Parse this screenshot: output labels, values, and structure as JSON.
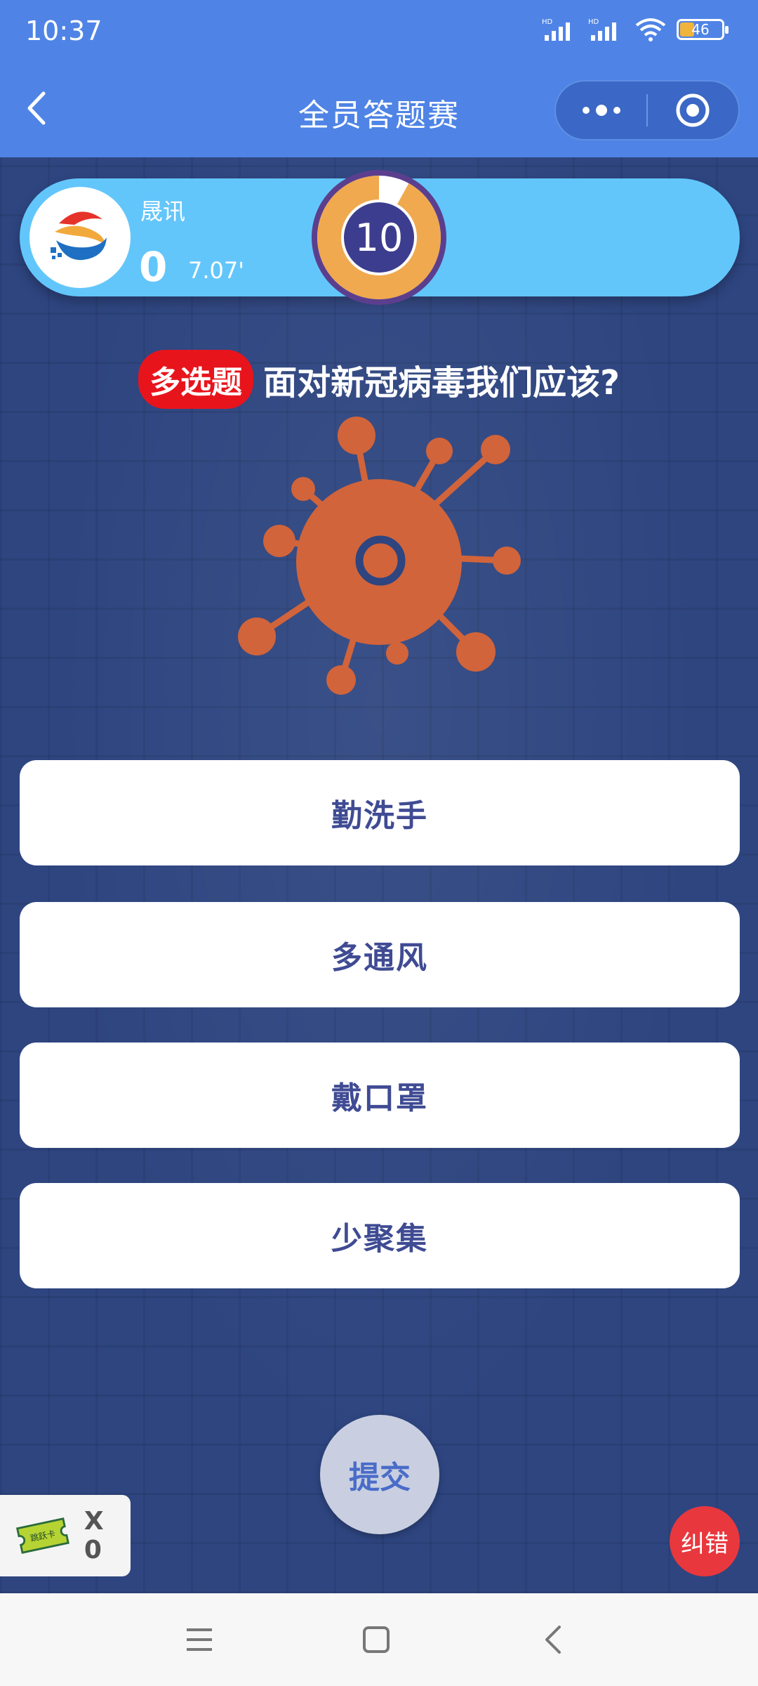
{
  "status_bar": {
    "time": "10:37",
    "battery": "46"
  },
  "nav": {
    "title": "全员答题赛"
  },
  "player": {
    "name": "晟讯",
    "score": "0",
    "time": "7.07'"
  },
  "timer": {
    "seconds": "10",
    "progress_fraction": 0.92
  },
  "question": {
    "type_badge": "多选题",
    "text": "面对新冠病毒我们应该?"
  },
  "options": [
    {
      "label": "勤洗手"
    },
    {
      "label": "多通风"
    },
    {
      "label": "戴口罩"
    },
    {
      "label": "少聚集"
    }
  ],
  "submit_label": "提交",
  "skip_card": {
    "card_text": "跳跃卡",
    "count": "X 0"
  },
  "report_label": "纠错",
  "colors": {
    "header": "#4f84e6",
    "background": "#2e4580",
    "player_bar": "#63c6fb",
    "timer_ring": "#f0a94f",
    "timer_center": "#3d3d8f",
    "virus": "#d1643a",
    "badge": "#e8141c",
    "report": "#e8383d"
  },
  "icons": {
    "back": "chevron-left-icon",
    "more": "more-dots-icon",
    "target": "target-icon",
    "virus": "virus-icon",
    "skip_card": "ticket-icon",
    "sys_menu": "menu-icon",
    "sys_home": "square-icon",
    "sys_back": "back-icon"
  }
}
